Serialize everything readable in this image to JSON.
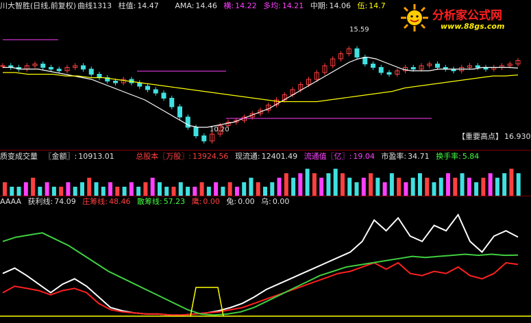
{
  "top_bar": {
    "title": "川大智胜(日线,前复权)",
    "curve": "曲线1313",
    "zhuwei_label": "柱值:",
    "zhuwei_value": "14.47",
    "ama_label": "AMA:",
    "ama_value": "14.46",
    "heng_label": "横:",
    "heng_value": "14.22",
    "duojun_label": "多均:",
    "duojun_value": "14.21",
    "zhongqi_label": "中期:",
    "zhongqi_value": "14.06",
    "wu_label": "伍:",
    "wu_value": "14.7"
  },
  "logo": {
    "title": "分析家公式网",
    "url": "www.88gs.com"
  },
  "price_annotations": {
    "high": "15.59",
    "low": "10.20",
    "marker": "【重要高点】",
    "marker_value": "16.930"
  },
  "volume_bar": {
    "name": "质变成交量",
    "amount_label": "〖金额〗:",
    "amount_value": "10913.01",
    "total_label": "总股本〖万股〗:",
    "total_value": "13924.56",
    "circ_label": "现流通:",
    "circ_value": "12401.49",
    "circ_mv_label": "流通值〖亿〗:",
    "circ_mv_value": "19.04",
    "pe_label": "市盈率:",
    "pe_value": "34.71",
    "turnover_label": "换手率:",
    "turnover_value": "5.84"
  },
  "indicator_bar": {
    "name": "AAAA",
    "profit_label": "获利线:",
    "profit_value": "74.09",
    "zhuang_label": "庄筹线:",
    "zhuang_value": "48.46",
    "sanchou_label": "散筹线:",
    "sanchou_value": "57.23",
    "ying_label": "鹰:",
    "ying_value": "0.00",
    "tu_label": "兔:",
    "tu_value": "0.00",
    "niao_label": "乌:",
    "niao_value": "0.00"
  },
  "colors": {
    "up": "#ff4040",
    "down": "#40e0e0",
    "up_alt": "#ff40ff",
    "ma_white": "#ffffff",
    "ma_yellow": "#ffff00",
    "profit_line": "#ffffff",
    "zhuang_line": "#ff2020",
    "sanchou_line": "#40d040"
  },
  "chart_data": [
    {
      "type": "line",
      "title": "川大智胜(日线,前复权)",
      "note": "Candlestick price panel",
      "ylim": [
        10,
        17
      ],
      "series": [
        {
          "name": "价格",
          "values": [
            14.6,
            14.5,
            14.4,
            14.6,
            14.7,
            14.5,
            14.4,
            14.3,
            14.5,
            14.6,
            14.4,
            14.1,
            13.9,
            13.7,
            13.6,
            13.8,
            13.6,
            13.4,
            13.2,
            13.0,
            12.7,
            12.2,
            11.6,
            11.0,
            10.5,
            10.2,
            10.6,
            11.1,
            11.3,
            11.4,
            11.6,
            11.8,
            12.0,
            12.3,
            12.6,
            12.9,
            13.2,
            13.5,
            13.8,
            14.2,
            14.6,
            15.0,
            15.3,
            15.59,
            15.1,
            14.7,
            14.5,
            14.2,
            14.1,
            14.3,
            14.5,
            14.4,
            14.6,
            14.7,
            14.5,
            14.4,
            14.3,
            14.5,
            14.6,
            14.5,
            14.4,
            14.5,
            14.6,
            14.7,
            14.9
          ]
        },
        {
          "name": "AMA",
          "values": [
            14.5,
            14.5,
            14.4,
            14.4,
            14.4,
            14.3,
            14.2,
            14.1,
            14.0,
            13.9,
            13.8,
            13.6,
            13.4,
            13.2,
            13.0,
            12.8,
            12.6,
            12.3,
            12.0,
            11.7,
            11.4,
            11.1,
            11.0,
            11.0,
            11.1,
            11.2,
            11.3,
            11.5,
            11.7,
            11.9,
            12.1,
            12.4,
            12.7,
            13.0,
            13.3,
            13.6,
            13.9,
            14.2,
            14.5,
            14.8,
            15.0,
            15.1,
            15.0,
            14.8,
            14.6,
            14.4,
            14.3,
            14.3,
            14.3,
            14.4,
            14.4,
            14.4,
            14.4,
            14.4,
            14.5,
            14.5,
            14.5,
            14.5,
            14.46
          ]
        },
        {
          "name": "中期",
          "values": [
            14.2,
            14.2,
            14.1,
            14.1,
            14.1,
            14.0,
            14.0,
            13.9,
            13.9,
            13.8,
            13.7,
            13.6,
            13.5,
            13.4,
            13.3,
            13.2,
            13.1,
            13.0,
            12.9,
            12.8,
            12.7,
            12.6,
            12.5,
            12.5,
            12.5,
            12.5,
            12.6,
            12.7,
            12.8,
            12.9,
            13.0,
            13.1,
            13.3,
            13.4,
            13.5,
            13.6,
            13.7,
            13.8,
            13.9,
            14.0,
            14.0,
            14.06
          ]
        }
      ]
    },
    {
      "type": "bar",
      "title": "质变成交量",
      "values": [
        3,
        2,
        2,
        3,
        4,
        2,
        3,
        2,
        2,
        3,
        2,
        3,
        4,
        3,
        2,
        3,
        2,
        2,
        3,
        2,
        3,
        4,
        3,
        2,
        2,
        3,
        2,
        2,
        3,
        2,
        3,
        2,
        3,
        2,
        3,
        4,
        3,
        2,
        3,
        4,
        5,
        4,
        5,
        6,
        5,
        4,
        5,
        6,
        5,
        4,
        3,
        4,
        5,
        4,
        3,
        5,
        4,
        3,
        4,
        5,
        4,
        3,
        4,
        5,
        4,
        5,
        4,
        3,
        4,
        5,
        4,
        5,
        6,
        5
      ]
    },
    {
      "type": "line",
      "title": "AAAA",
      "ylim": [
        0,
        100
      ],
      "series": [
        {
          "name": "获利线",
          "values": [
            40,
            45,
            38,
            30,
            22,
            30,
            35,
            28,
            18,
            8,
            5,
            3,
            2,
            2,
            1,
            1,
            2,
            3,
            5,
            8,
            12,
            18,
            25,
            30,
            35,
            40,
            45,
            50,
            55,
            60,
            70,
            90,
            80,
            92,
            75,
            70,
            85,
            80,
            95,
            70,
            60,
            75,
            80,
            74.09
          ]
        },
        {
          "name": "庄筹线",
          "values": [
            22,
            28,
            26,
            24,
            20,
            24,
            26,
            22,
            12,
            6,
            4,
            3,
            2,
            2,
            1,
            1,
            2,
            3,
            4,
            6,
            8,
            12,
            16,
            20,
            24,
            28,
            32,
            36,
            40,
            42,
            46,
            50,
            44,
            50,
            40,
            38,
            42,
            40,
            46,
            38,
            35,
            40,
            50,
            48.46
          ]
        },
        {
          "name": "散筹线",
          "values": [
            70,
            74,
            76,
            78,
            72,
            66,
            58,
            50,
            42,
            36,
            30,
            24,
            18,
            12,
            6,
            2,
            1,
            2,
            4,
            8,
            14,
            20,
            26,
            32,
            38,
            42,
            46,
            48,
            50,
            52,
            54,
            56,
            55,
            56,
            57,
            58,
            57,
            58,
            57,
            57.23
          ]
        }
      ]
    }
  ]
}
